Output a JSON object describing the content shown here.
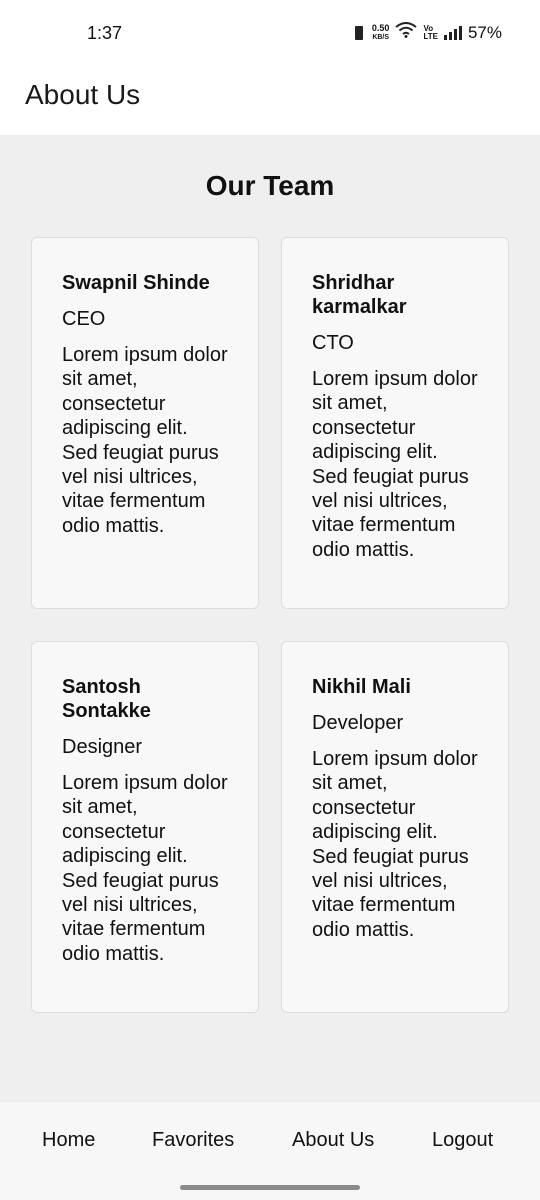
{
  "status_bar": {
    "time": "1:37",
    "net_speed_value": "0.50",
    "net_speed_unit": "KB/S",
    "volte_top": "Vo",
    "volte_bottom": "LTE",
    "battery": "57%",
    "icons": [
      "vibrate-icon",
      "wifi-icon",
      "signal-icon"
    ]
  },
  "app_bar": {
    "title": "About Us"
  },
  "section": {
    "title": "Our Team"
  },
  "team": [
    {
      "name": "Swapnil Shinde",
      "role": "CEO",
      "description": "Lorem ipsum dolor sit amet, consectetur adipiscing elit. Sed feugiat purus vel nisi ultrices, vitae fermentum odio mattis."
    },
    {
      "name": "Shridhar karmalkar",
      "role": "CTO",
      "description": "Lorem ipsum dolor sit amet, consectetur adipiscing elit. Sed feugiat purus vel nisi ultrices, vitae fermentum odio mattis."
    },
    {
      "name": "Santosh Sontakke",
      "role": "Designer",
      "description": "Lorem ipsum dolor sit amet, consectetur adipiscing elit. Sed feugiat purus vel nisi ultrices, vitae fermentum odio mattis."
    },
    {
      "name": "Nikhil Mali",
      "role": "Developer",
      "description": "Lorem ipsum dolor sit amet, consectetur adipiscing elit. Sed feugiat purus vel nisi ultrices, vitae fermentum odio mattis."
    }
  ],
  "bottom_nav": {
    "items": [
      "Home",
      "Favorites",
      "About Us",
      "Logout"
    ]
  },
  "colors": {
    "background": "#efefef",
    "card": "#f8f8f8",
    "bar": "#ffffff",
    "nav": "#f7f7f7"
  }
}
